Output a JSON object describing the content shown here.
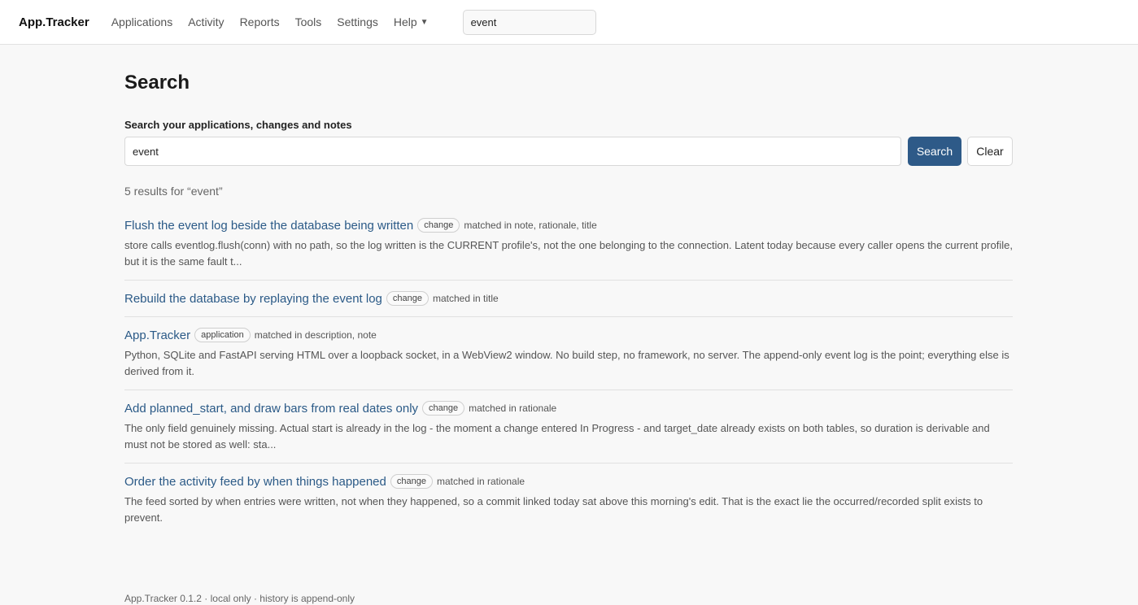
{
  "topbar": {
    "brand": "App.Tracker",
    "nav": [
      "Applications",
      "Activity",
      "Reports",
      "Tools",
      "Settings"
    ],
    "help_label": "Help",
    "search_value": "event"
  },
  "main": {
    "title": "Search",
    "search_label": "Search your applications, changes and notes",
    "search_value": "event",
    "search_button": "Search",
    "clear_button": "Clear",
    "summary": "5 results for “event”",
    "results": [
      {
        "title": "Flush the event log beside the database being written",
        "badge": "change",
        "matched": "matched in note, rationale, title",
        "snippet": "store calls eventlog.flush(conn) with no path, so the log written is the CURRENT profile's, not the one belonging to the connection. Latent today because every caller opens the current profile, but it is the same fault t..."
      },
      {
        "title": "Rebuild the database by replaying the event log",
        "badge": "change",
        "matched": "matched in title",
        "snippet": ""
      },
      {
        "title": "App.Tracker",
        "badge": "application",
        "matched": "matched in description, note",
        "snippet": "Python, SQLite and FastAPI serving HTML over a loopback socket, in a WebView2 window. No build step, no framework, no server. The append-only event log is the point; everything else is derived from it."
      },
      {
        "title": "Add planned_start, and draw bars from real dates only",
        "badge": "change",
        "matched": "matched in rationale",
        "snippet": "The only field genuinely missing. Actual start is already in the log - the moment a change entered In Progress - and target_date already exists on both tables, so duration is derivable and must not be stored as well: sta..."
      },
      {
        "title": "Order the activity feed by when things happened",
        "badge": "change",
        "matched": "matched in rationale",
        "snippet": "The feed sorted by when entries were written, not when they happened, so a commit linked today sat above this morning's edit. That is the exact lie the occurred/recorded split exists to prevent."
      }
    ]
  },
  "footer": {
    "text": "App.Tracker 0.1.2 · local only · history is append-only"
  }
}
